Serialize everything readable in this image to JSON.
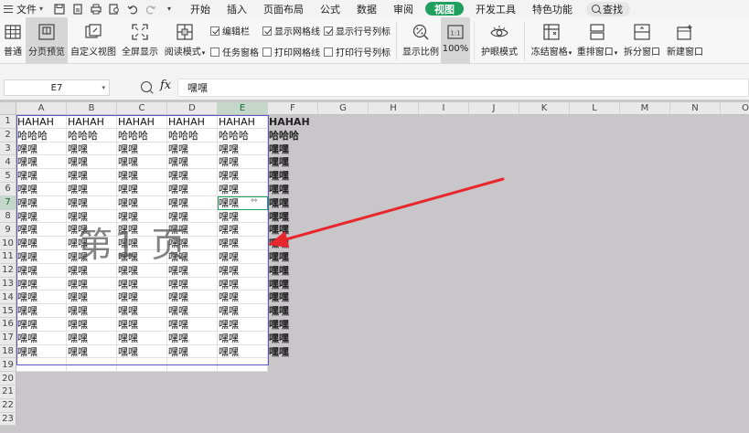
{
  "menubar": {
    "file_label": "文件",
    "items": [
      "开始",
      "插入",
      "页面布局",
      "公式",
      "数据",
      "审阅",
      "视图",
      "开发工具",
      "特色功能"
    ],
    "active_item": "视图",
    "search_label": "查找"
  },
  "ribbon": {
    "normal": "普通",
    "page_break_preview": "分页预览",
    "custom_view": "自定义视图",
    "full_screen": "全屏显示",
    "reading_mode": "阅读模式",
    "edit_bar": "编辑栏",
    "task_pane": "任务窗格",
    "show_gridlines": "显示网格线",
    "print_gridlines": "打印网格线",
    "show_row_col_headers": "显示行号列标",
    "print_row_col_headers": "打印行号列标",
    "show_ratio": "显示比例",
    "zoom_100": "100%",
    "eye_protection": "护眼模式",
    "freeze_panes": "冻结窗格",
    "rearrange_windows": "重排窗口",
    "split_window": "拆分窗口",
    "new_window": "新建窗口"
  },
  "formula_bar": {
    "name_box": "E7",
    "fx": "fx",
    "content": "嘿嘿"
  },
  "sheet": {
    "columns": [
      "A",
      "B",
      "C",
      "D",
      "E",
      "F",
      "G",
      "H",
      "I",
      "J",
      "K",
      "L",
      "M",
      "N",
      "O"
    ],
    "selected_column": "E",
    "rows": [
      "1",
      "2",
      "3",
      "4",
      "5",
      "6",
      "7",
      "8",
      "9",
      "10",
      "11",
      "12",
      "13",
      "14",
      "15",
      "16",
      "17",
      "18",
      "19",
      "20",
      "21",
      "22",
      "23"
    ],
    "selected_row": "7",
    "row1": "HAHAH",
    "row2": "哈哈哈",
    "body": "嘿嘿",
    "watermark": "第1 页"
  },
  "colors": {
    "accent_green": "#1fa05e",
    "page_frame": "#5b57c9",
    "arrow_red": "#e8262d"
  }
}
